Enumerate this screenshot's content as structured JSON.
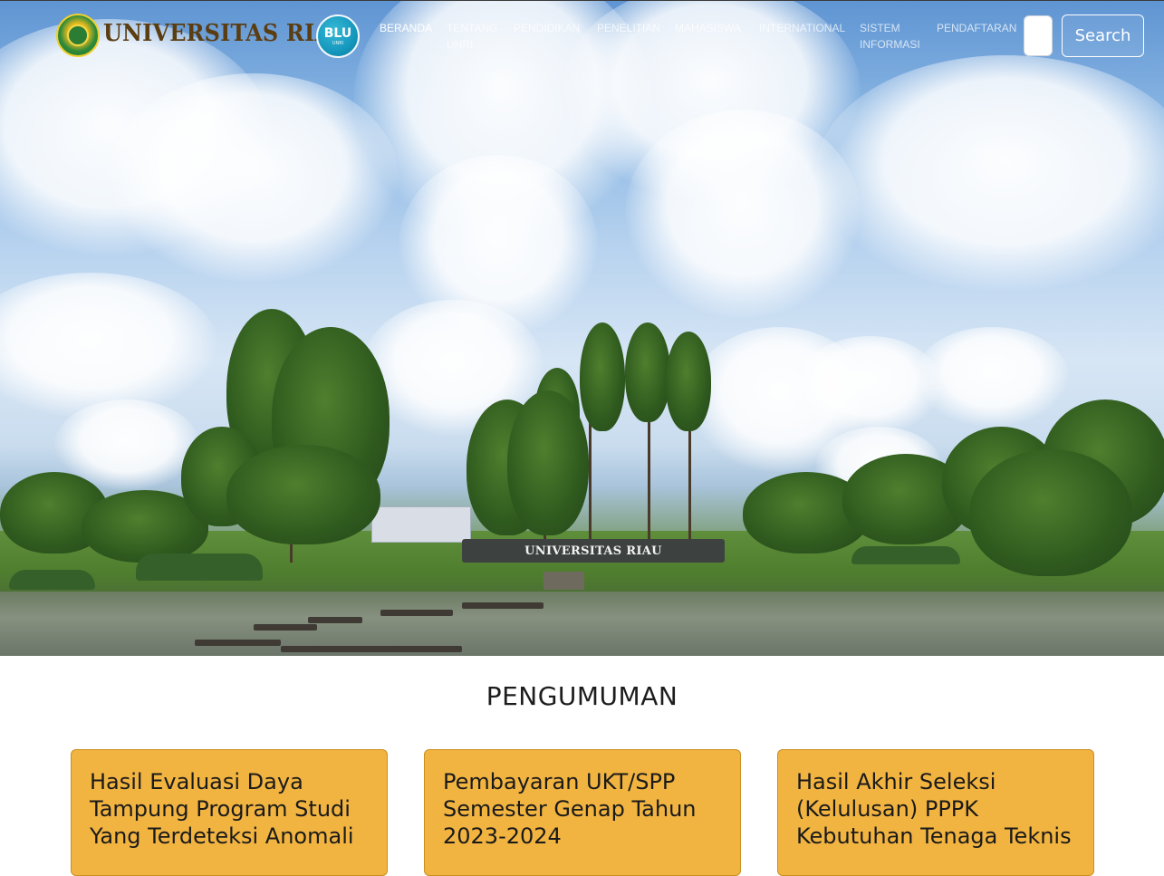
{
  "header": {
    "brand_text": "UNIVERSITAS RIAU",
    "badge_text": "BLU",
    "badge_subtext": "UNRI"
  },
  "nav": {
    "items": [
      {
        "label": "BERANDA",
        "active": true
      },
      {
        "label": "TENTANG\nUNRI",
        "active": false
      },
      {
        "label": "PENDIDIKAN",
        "active": false
      },
      {
        "label": "PENELITIAN",
        "active": false
      },
      {
        "label": "MAHASISWA",
        "active": false
      },
      {
        "label": "INTERNATIONAL",
        "active": false
      },
      {
        "label": "SISTEM\nINFORMASI",
        "active": false
      },
      {
        "label": "PENDAFTARAN",
        "active": false
      }
    ]
  },
  "search": {
    "placeholder": "",
    "button_label": "Search"
  },
  "hero": {
    "sign_text": "UNIVERSITAS RIAU"
  },
  "announcements": {
    "title": "PENGUMUMAN",
    "cards": [
      {
        "title": "Hasil Evaluasi Daya Tampung Program Studi Yang Terdeteksi Anomali"
      },
      {
        "title": "Pembayaran UKT/SPP Semester Genap Tahun 2023-2024"
      },
      {
        "title": "Hasil Akhir Seleksi (Kelulusan) PPPK Kebutuhan Tenaga Teknis"
      }
    ]
  },
  "colors": {
    "card_background": "#f2b441",
    "brand_text": "#5b3d12",
    "badge": "#1598bd"
  }
}
